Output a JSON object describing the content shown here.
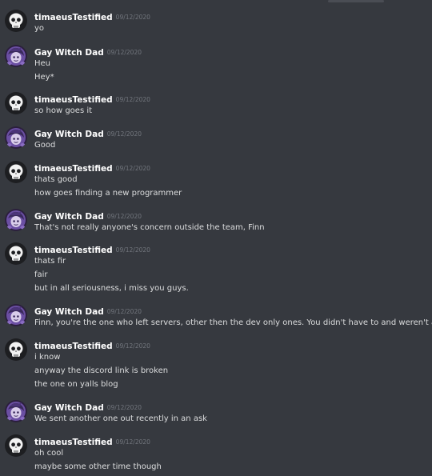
{
  "channel": {
    "messages": [
      {
        "author": "timaeusTestified",
        "avatar": "skull-avatar",
        "timestamp": "09/12/2020",
        "lines": [
          "yo"
        ]
      },
      {
        "author": "Gay Witch Dad",
        "avatar": "witch-avatar",
        "timestamp": "09/12/2020",
        "lines": [
          "Heu",
          "Hey*"
        ]
      },
      {
        "author": "timaeusTestified",
        "avatar": "skull-avatar",
        "timestamp": "09/12/2020",
        "lines": [
          "so how goes it"
        ]
      },
      {
        "author": "Gay Witch Dad",
        "avatar": "witch-avatar",
        "timestamp": "09/12/2020",
        "lines": [
          "Good"
        ]
      },
      {
        "author": "timaeusTestified",
        "avatar": "skull-avatar",
        "timestamp": "09/12/2020",
        "lines": [
          "thats good",
          "how goes finding a new programmer"
        ]
      },
      {
        "author": "Gay Witch Dad",
        "avatar": "witch-avatar",
        "timestamp": "09/12/2020",
        "lines": [
          "That's not really anyone's concern outside the team, Finn"
        ]
      },
      {
        "author": "timaeusTestified",
        "avatar": "skull-avatar",
        "timestamp": "09/12/2020",
        "lines": [
          "thats fir",
          "fair",
          "but in all seriousness, i miss you guys."
        ]
      },
      {
        "author": "Gay Witch Dad",
        "avatar": "witch-avatar",
        "timestamp": "09/12/2020",
        "lines": [
          "Finn, you're the one who left servers, other then the dev only ones. You didn't have to and weren't asked to"
        ]
      },
      {
        "author": "timaeusTestified",
        "avatar": "skull-avatar",
        "timestamp": "09/12/2020",
        "lines": [
          "i know",
          "anyway the discord link is broken",
          "the one on yalls blog"
        ]
      },
      {
        "author": "Gay Witch Dad",
        "avatar": "witch-avatar",
        "timestamp": "09/12/2020",
        "lines": [
          "We sent another one out recently in an ask"
        ]
      },
      {
        "author": "timaeusTestified",
        "avatar": "skull-avatar",
        "timestamp": "09/12/2020",
        "lines": [
          "oh cool",
          "maybe some other time though"
        ]
      }
    ]
  },
  "colors": {
    "background": "#36393f",
    "username": "#ffffff",
    "timestamp": "#72767d",
    "message_text": "#dcddde"
  }
}
